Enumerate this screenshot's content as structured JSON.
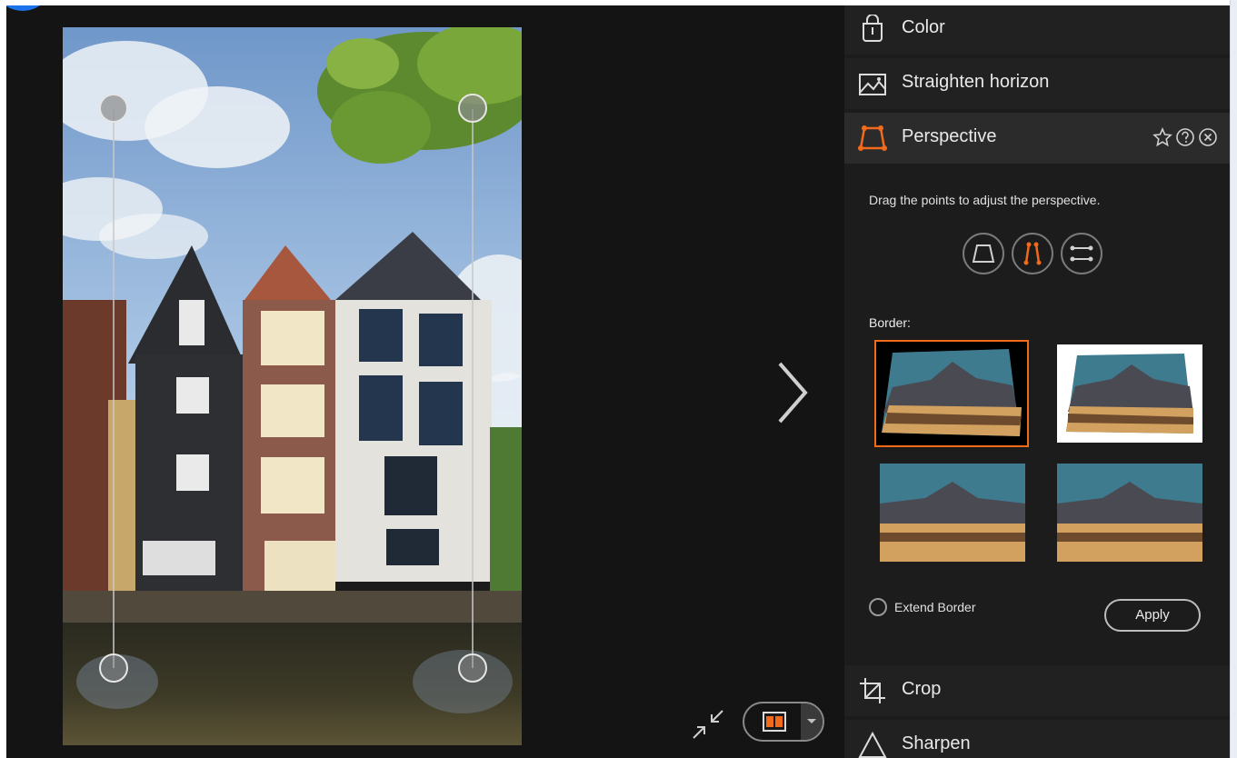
{
  "panel": {
    "tools_top": [
      {
        "label": "Color",
        "icon": "color-icon"
      },
      {
        "label": "Straighten horizon",
        "icon": "straighten-horizon-icon"
      },
      {
        "label": "Perspective",
        "icon": "perspective-icon"
      }
    ],
    "tools_bottom": [
      {
        "label": "Crop",
        "icon": "crop-icon"
      },
      {
        "label": "Sharpen",
        "icon": "sharpen-icon"
      }
    ],
    "perspective": {
      "hint": "Drag the points to adjust the perspective.",
      "modes": [
        "trapezoid-mode-icon",
        "vertical-lines-mode-icon",
        "horizontal-lines-mode-icon"
      ],
      "active_mode": 1,
      "border_label": "Border:",
      "border_options": [
        "black-border",
        "white-border",
        "crop-border",
        "stretch-border"
      ],
      "selected_border": 0,
      "extend_border_label": "Extend Border",
      "extend_border_checked": false,
      "apply_label": "Apply"
    }
  },
  "colors": {
    "accent": "#f26a1b",
    "panel_bg": "#1c1c1c",
    "canvas_bg": "#141414"
  }
}
